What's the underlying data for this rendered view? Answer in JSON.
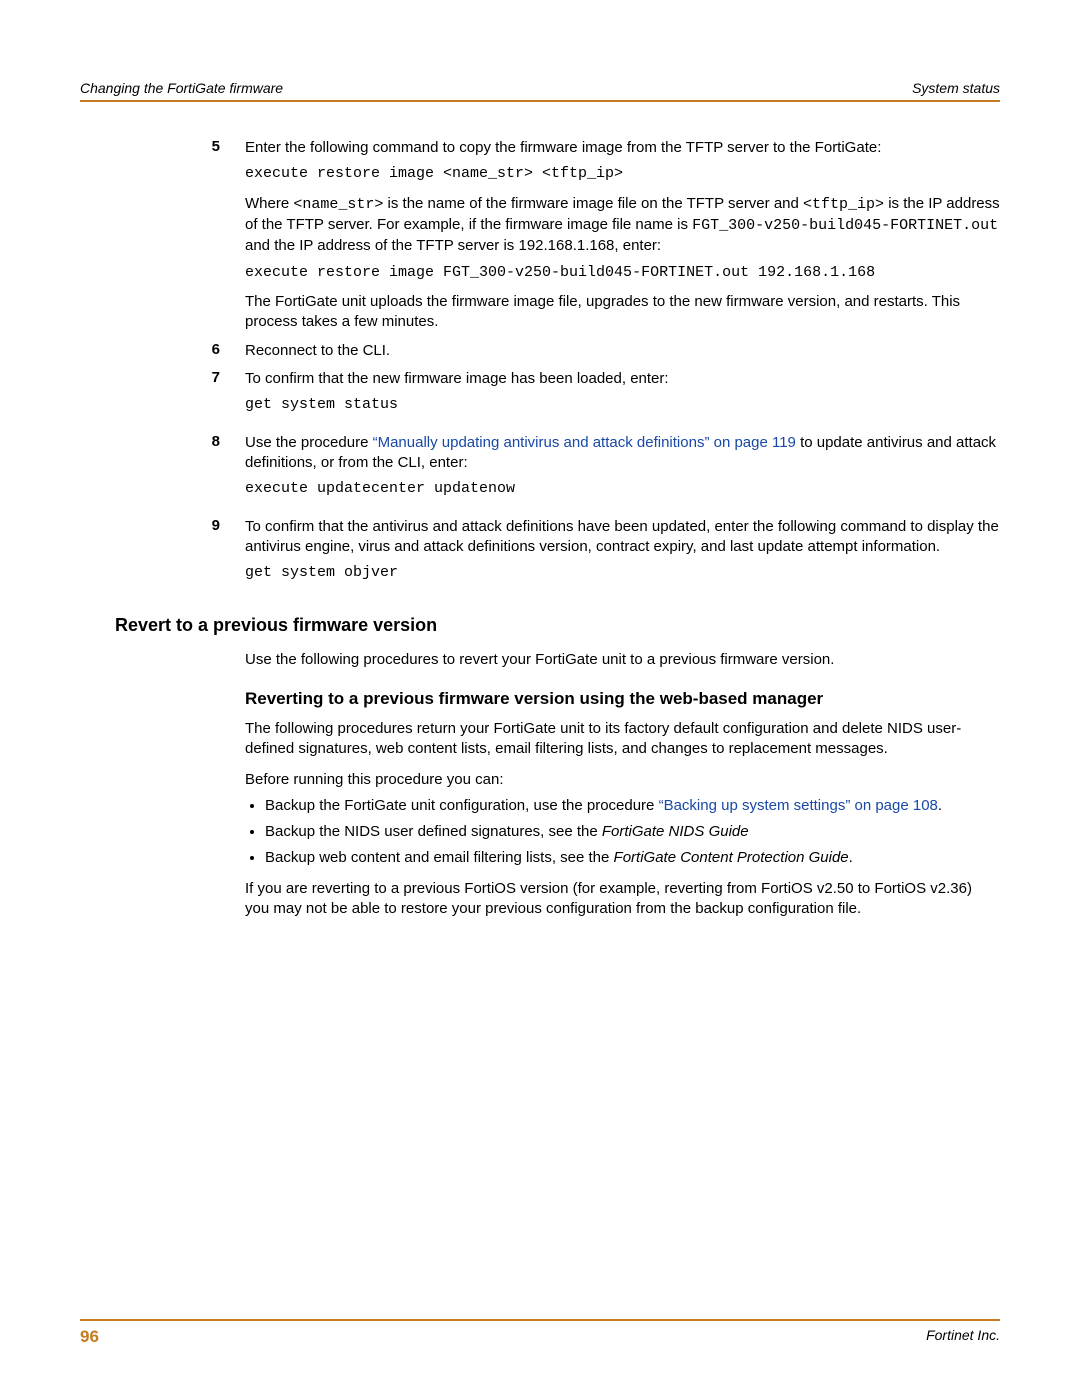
{
  "header": {
    "left": "Changing the FortiGate firmware",
    "right": "System status"
  },
  "footer": {
    "page": "96",
    "company": "Fortinet Inc."
  },
  "steps": {
    "s5": {
      "num": "5",
      "intro": "Enter the following command to copy the firmware image from the TFTP server to the FortiGate:",
      "cmd1": "execute restore image <name_str> <tftp_ip>",
      "where_a": "Where ",
      "where_b": "<name_str>",
      "where_c": " is the name of the firmware image file on the TFTP server and ",
      "where_d": "<tftp_ip>",
      "where_e": " is the IP address of the TFTP server. For example, if the firmware image file name is ",
      "where_f": "FGT_300-v250-build045-FORTINET.out",
      "where_g": " and the IP address of the TFTP server is 192.168.1.168, enter:",
      "cmd2": "execute restore image FGT_300-v250-build045-FORTINET.out 192.168.1.168",
      "result": "The FortiGate unit uploads the firmware image file, upgrades to the new firmware version, and restarts. This process takes a few minutes."
    },
    "s6": {
      "num": "6",
      "text": "Reconnect to the CLI."
    },
    "s7": {
      "num": "7",
      "text": "To confirm that the new firmware image has been loaded, enter:",
      "cmd": "get system status"
    },
    "s8": {
      "num": "8",
      "pre": "Use the procedure ",
      "link": "“Manually updating antivirus and attack definitions” on page 119",
      "post": " to update antivirus and attack definitions, or from the CLI, enter:",
      "cmd": "execute updatecenter updatenow"
    },
    "s9": {
      "num": "9",
      "text": "To confirm that the antivirus and attack definitions have been updated, enter the following command to display the antivirus engine, virus and attack definitions version, contract expiry, and last update attempt information.",
      "cmd": "get system objver"
    }
  },
  "section": {
    "title": "Revert to a previous firmware version",
    "intro": "Use the following procedures to revert your FortiGate unit to a previous firmware version.",
    "sub_title": "Reverting to a previous firmware version using the web-based manager",
    "p1": "The following procedures return your FortiGate unit to its factory default configuration and delete NIDS user-defined signatures, web content lists, email filtering lists, and changes to replacement messages.",
    "p2": "Before running this procedure you can:",
    "b1_pre": "Backup the FortiGate unit configuration, use the procedure ",
    "b1_link": "“Backing up system settings” on page 108",
    "b1_post": ".",
    "b2_pre": "Backup the NIDS user defined signatures, see the ",
    "b2_ital": "FortiGate NIDS Guide",
    "b3_pre": "Backup web content and email filtering lists, see the ",
    "b3_ital": "FortiGate Content Protection Guide",
    "b3_post": ".",
    "p3": "If you are reverting to a previous FortiOS version (for example, reverting from FortiOS v2.50 to FortiOS v2.36) you may not be able to restore your previous configuration from the backup configuration file."
  }
}
